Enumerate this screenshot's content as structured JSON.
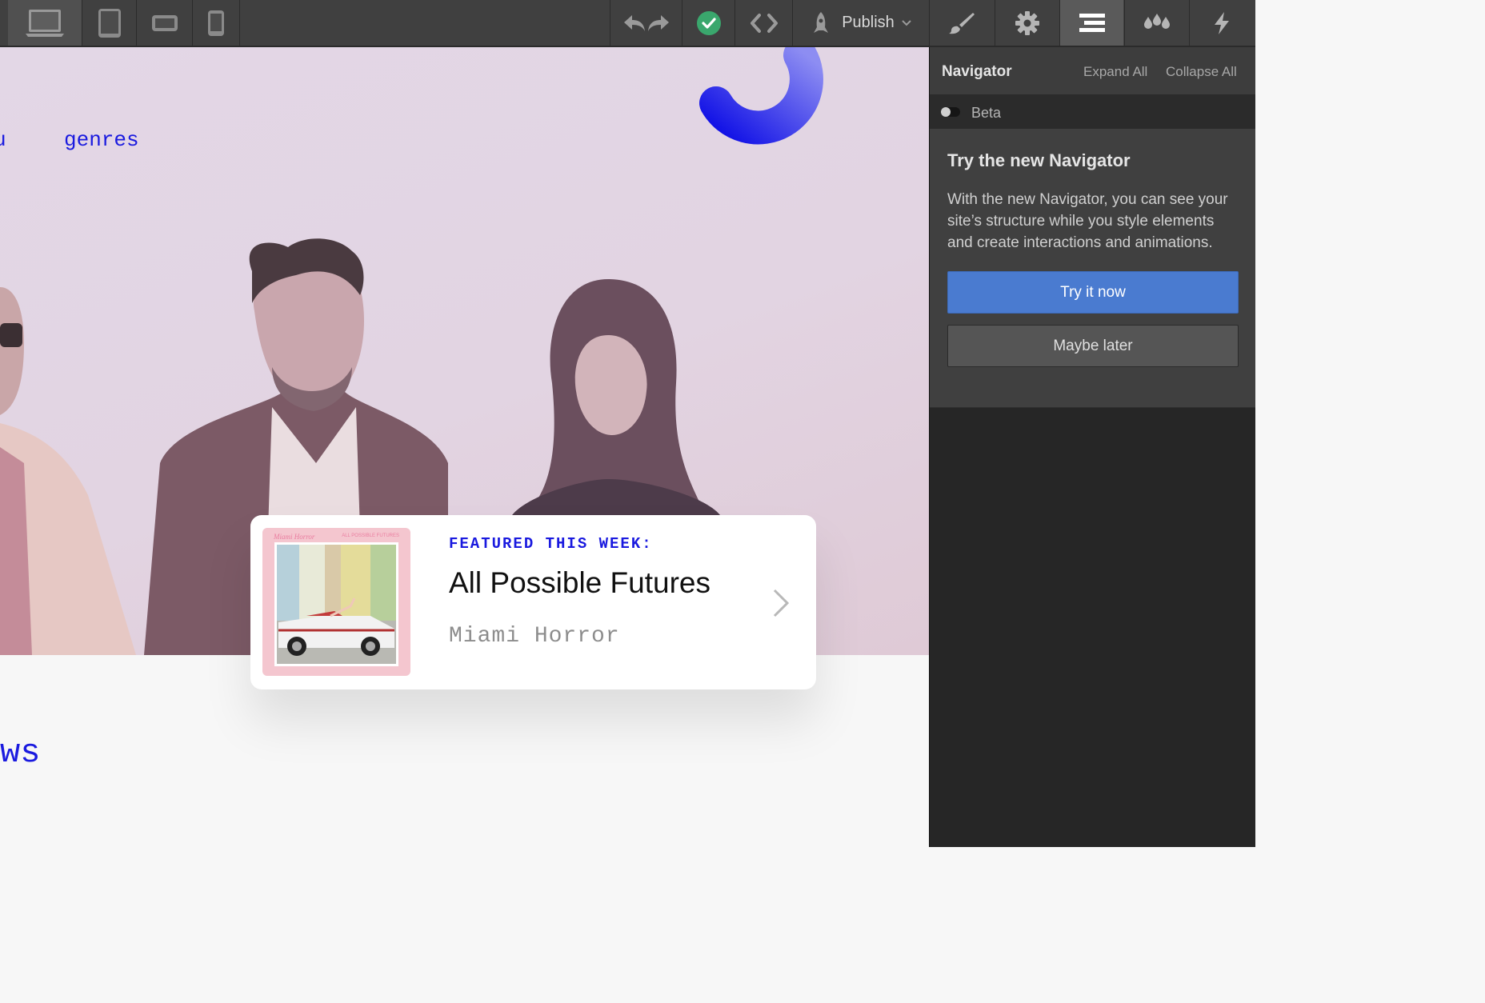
{
  "toolbar": {
    "devices": [
      "desktop-icon",
      "tablet-icon",
      "mobile-landscape-icon",
      "mobile-portrait-icon"
    ],
    "undo_icon": "undo-icon",
    "redo_icon": "redo-icon",
    "status_icon": "check-circle-icon",
    "status_color": "#3aa76d",
    "code_icon": "code-brackets-icon",
    "publish_label": "Publish"
  },
  "panel_tabs": [
    "brush-icon",
    "gear-icon",
    "navigator-icon",
    "drops-icon",
    "lightning-icon"
  ],
  "navigator": {
    "title": "Navigator",
    "expand_all": "Expand All",
    "collapse_all": "Collapse All",
    "beta_label": "Beta",
    "promo_title": "Try the new Navigator",
    "promo_text": "With the new Navigator, you can see your site’s structure while you style elements and create interactions and animations.",
    "try_label": "Try it now",
    "later_label": "Maybe later",
    "accent": "#4a7bd0"
  },
  "site": {
    "nav_left_partial": "u",
    "nav_genres": "genres",
    "bottom_title_partial": "ws",
    "brand_blue": "#1a1adf",
    "featured": {
      "label": "FEATURED THIS WEEK:",
      "album_title": "All Possible Futures",
      "artist": "Miami Horror",
      "cover_title": "Miami Horror",
      "cover_subtitle": "ALL POSSIBLE FUTURES"
    }
  }
}
